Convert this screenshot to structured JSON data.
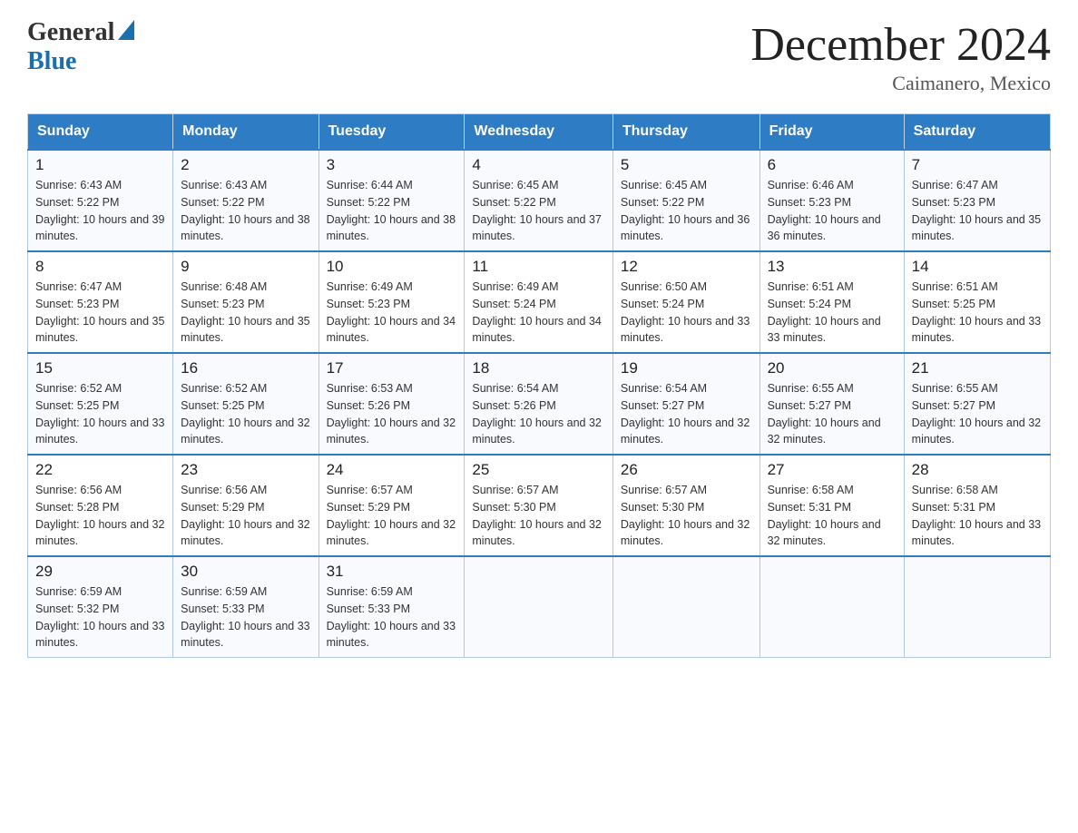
{
  "logo": {
    "general": "General",
    "blue": "Blue",
    "triangle": "▲"
  },
  "title": "December 2024",
  "subtitle": "Caimanero, Mexico",
  "headers": [
    "Sunday",
    "Monday",
    "Tuesday",
    "Wednesday",
    "Thursday",
    "Friday",
    "Saturday"
  ],
  "weeks": [
    [
      {
        "day": "1",
        "sunrise": "6:43 AM",
        "sunset": "5:22 PM",
        "daylight": "10 hours and 39 minutes."
      },
      {
        "day": "2",
        "sunrise": "6:43 AM",
        "sunset": "5:22 PM",
        "daylight": "10 hours and 38 minutes."
      },
      {
        "day": "3",
        "sunrise": "6:44 AM",
        "sunset": "5:22 PM",
        "daylight": "10 hours and 38 minutes."
      },
      {
        "day": "4",
        "sunrise": "6:45 AM",
        "sunset": "5:22 PM",
        "daylight": "10 hours and 37 minutes."
      },
      {
        "day": "5",
        "sunrise": "6:45 AM",
        "sunset": "5:22 PM",
        "daylight": "10 hours and 36 minutes."
      },
      {
        "day": "6",
        "sunrise": "6:46 AM",
        "sunset": "5:23 PM",
        "daylight": "10 hours and 36 minutes."
      },
      {
        "day": "7",
        "sunrise": "6:47 AM",
        "sunset": "5:23 PM",
        "daylight": "10 hours and 35 minutes."
      }
    ],
    [
      {
        "day": "8",
        "sunrise": "6:47 AM",
        "sunset": "5:23 PM",
        "daylight": "10 hours and 35 minutes."
      },
      {
        "day": "9",
        "sunrise": "6:48 AM",
        "sunset": "5:23 PM",
        "daylight": "10 hours and 35 minutes."
      },
      {
        "day": "10",
        "sunrise": "6:49 AM",
        "sunset": "5:23 PM",
        "daylight": "10 hours and 34 minutes."
      },
      {
        "day": "11",
        "sunrise": "6:49 AM",
        "sunset": "5:24 PM",
        "daylight": "10 hours and 34 minutes."
      },
      {
        "day": "12",
        "sunrise": "6:50 AM",
        "sunset": "5:24 PM",
        "daylight": "10 hours and 33 minutes."
      },
      {
        "day": "13",
        "sunrise": "6:51 AM",
        "sunset": "5:24 PM",
        "daylight": "10 hours and 33 minutes."
      },
      {
        "day": "14",
        "sunrise": "6:51 AM",
        "sunset": "5:25 PM",
        "daylight": "10 hours and 33 minutes."
      }
    ],
    [
      {
        "day": "15",
        "sunrise": "6:52 AM",
        "sunset": "5:25 PM",
        "daylight": "10 hours and 33 minutes."
      },
      {
        "day": "16",
        "sunrise": "6:52 AM",
        "sunset": "5:25 PM",
        "daylight": "10 hours and 32 minutes."
      },
      {
        "day": "17",
        "sunrise": "6:53 AM",
        "sunset": "5:26 PM",
        "daylight": "10 hours and 32 minutes."
      },
      {
        "day": "18",
        "sunrise": "6:54 AM",
        "sunset": "5:26 PM",
        "daylight": "10 hours and 32 minutes."
      },
      {
        "day": "19",
        "sunrise": "6:54 AM",
        "sunset": "5:27 PM",
        "daylight": "10 hours and 32 minutes."
      },
      {
        "day": "20",
        "sunrise": "6:55 AM",
        "sunset": "5:27 PM",
        "daylight": "10 hours and 32 minutes."
      },
      {
        "day": "21",
        "sunrise": "6:55 AM",
        "sunset": "5:27 PM",
        "daylight": "10 hours and 32 minutes."
      }
    ],
    [
      {
        "day": "22",
        "sunrise": "6:56 AM",
        "sunset": "5:28 PM",
        "daylight": "10 hours and 32 minutes."
      },
      {
        "day": "23",
        "sunrise": "6:56 AM",
        "sunset": "5:29 PM",
        "daylight": "10 hours and 32 minutes."
      },
      {
        "day": "24",
        "sunrise": "6:57 AM",
        "sunset": "5:29 PM",
        "daylight": "10 hours and 32 minutes."
      },
      {
        "day": "25",
        "sunrise": "6:57 AM",
        "sunset": "5:30 PM",
        "daylight": "10 hours and 32 minutes."
      },
      {
        "day": "26",
        "sunrise": "6:57 AM",
        "sunset": "5:30 PM",
        "daylight": "10 hours and 32 minutes."
      },
      {
        "day": "27",
        "sunrise": "6:58 AM",
        "sunset": "5:31 PM",
        "daylight": "10 hours and 32 minutes."
      },
      {
        "day": "28",
        "sunrise": "6:58 AM",
        "sunset": "5:31 PM",
        "daylight": "10 hours and 33 minutes."
      }
    ],
    [
      {
        "day": "29",
        "sunrise": "6:59 AM",
        "sunset": "5:32 PM",
        "daylight": "10 hours and 33 minutes."
      },
      {
        "day": "30",
        "sunrise": "6:59 AM",
        "sunset": "5:33 PM",
        "daylight": "10 hours and 33 minutes."
      },
      {
        "day": "31",
        "sunrise": "6:59 AM",
        "sunset": "5:33 PM",
        "daylight": "10 hours and 33 minutes."
      },
      null,
      null,
      null,
      null
    ]
  ],
  "labels": {
    "sunrise_prefix": "Sunrise: ",
    "sunset_prefix": "Sunset: ",
    "daylight_prefix": "Daylight: "
  }
}
